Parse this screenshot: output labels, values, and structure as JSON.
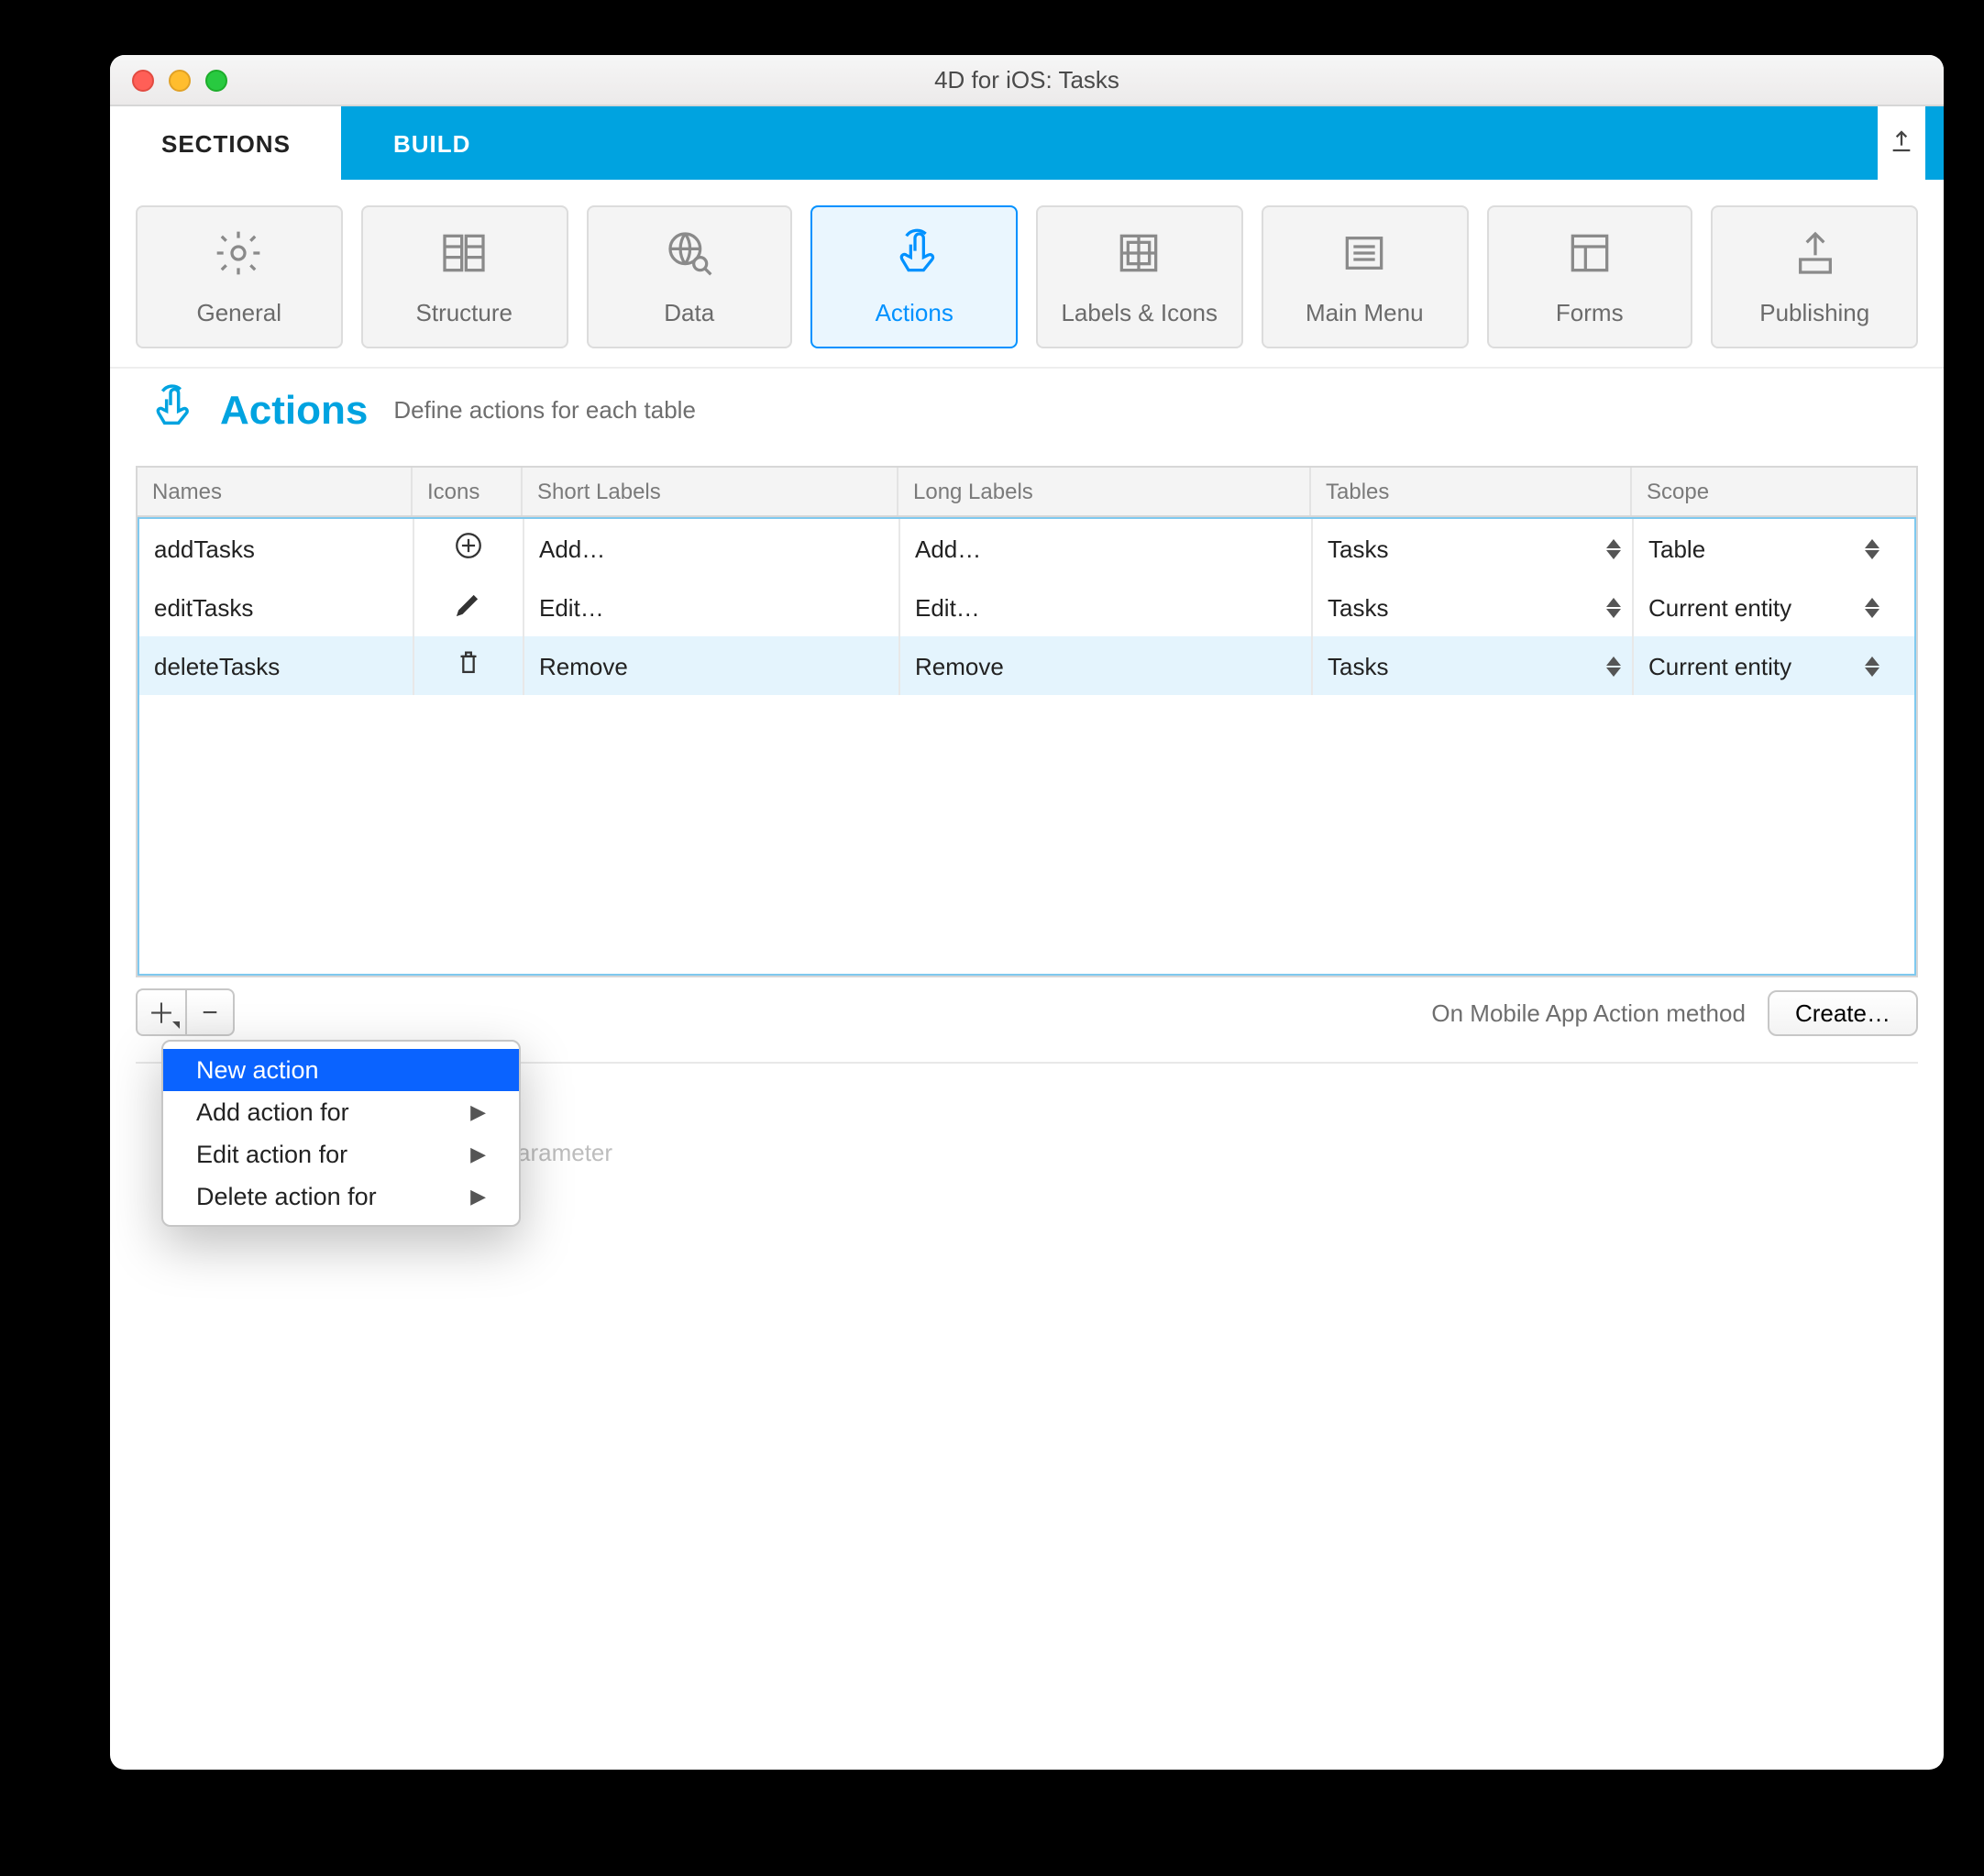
{
  "window": {
    "title": "4D for iOS: Tasks"
  },
  "tabs": {
    "sections": "SECTIONS",
    "build": "BUILD"
  },
  "sectionTiles": [
    {
      "key": "general",
      "label": "General"
    },
    {
      "key": "structure",
      "label": "Structure"
    },
    {
      "key": "data",
      "label": "Data"
    },
    {
      "key": "actions",
      "label": "Actions",
      "active": true
    },
    {
      "key": "labels",
      "label": "Labels & Icons"
    },
    {
      "key": "mainmenu",
      "label": "Main Menu"
    },
    {
      "key": "forms",
      "label": "Forms"
    },
    {
      "key": "publishing",
      "label": "Publishing"
    }
  ],
  "page": {
    "title": "Actions",
    "subtitle": "Define actions for each table"
  },
  "table": {
    "headers": {
      "names": "Names",
      "icons": "Icons",
      "short": "Short Labels",
      "long": "Long Labels",
      "tables": "Tables",
      "scope": "Scope"
    },
    "rows": [
      {
        "name": "addTasks",
        "icon": "plus-circle",
        "short": "Add…",
        "long": "Add…",
        "table": "Tasks",
        "scope": "Table",
        "selected": false
      },
      {
        "name": "editTasks",
        "icon": "pencil",
        "short": "Edit…",
        "long": "Edit…",
        "table": "Tasks",
        "scope": "Current entity",
        "selected": false
      },
      {
        "name": "deleteTasks",
        "icon": "trash",
        "short": "Remove",
        "long": "Remove",
        "table": "Tasks",
        "scope": "Current entity",
        "selected": true
      }
    ]
  },
  "toolbar": {
    "footerLabel": "On Mobile App Action method",
    "createBtn": "Create…"
  },
  "contextMenu": {
    "items": [
      {
        "label": "New action",
        "submenu": false,
        "highlight": true
      },
      {
        "label": "Add action for",
        "submenu": true
      },
      {
        "label": "Edit action for",
        "submenu": true
      },
      {
        "label": "Delete action for",
        "submenu": true
      }
    ]
  },
  "lowerPanel": {
    "hintTail": "arameter"
  }
}
